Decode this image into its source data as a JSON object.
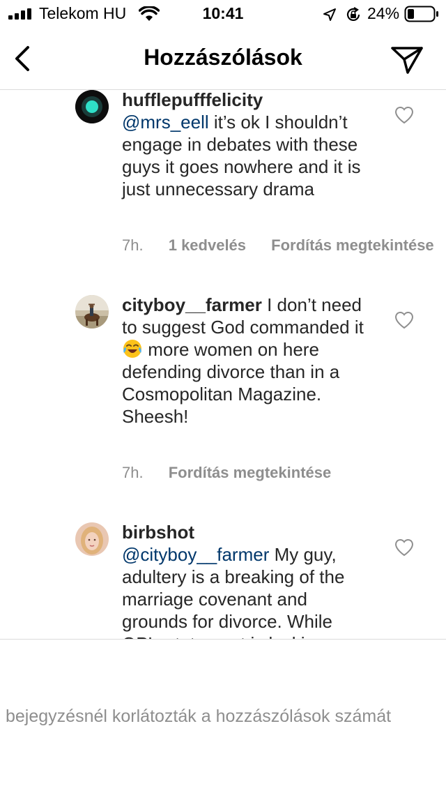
{
  "status_bar": {
    "carrier": "Telekom HU",
    "time": "10:41",
    "battery": "24%"
  },
  "header": {
    "title": "Hozzászólások"
  },
  "comments": [
    {
      "username": "hufflepufffelicity",
      "mention": "@mrs_eell",
      "text": " it’s ok I shouldn’t engage in debates with these guys it goes nowhere and it is just unnecessary drama",
      "time": "7h.",
      "likes": "1 kedvelés",
      "translate": "Fordítás megtekintése"
    },
    {
      "username": "cityboy__farmer",
      "text_before": " I don’t need to suggest God commanded it ",
      "emoji": "face-with-tears-of-joy",
      "text_after": " more women on here defending divorce than in a Cosmopolitan Magazine. Sheesh!",
      "time": "7h.",
      "translate": "Fordítás megtekintése"
    },
    {
      "username": "birbshot",
      "mention": "@cityboy__farmer",
      "text": " My guy, adultery is a breaking of the marriage covenant and grounds for divorce. While OP’s statement is lacking"
    }
  ],
  "footer": {
    "notice": "bejegyzésnél korlátozták a hozzászólások számát"
  },
  "colors": {
    "text": "#262626",
    "secondary": "#8e8e8e",
    "mention": "#00376b",
    "divider": "#dbdbdb"
  }
}
